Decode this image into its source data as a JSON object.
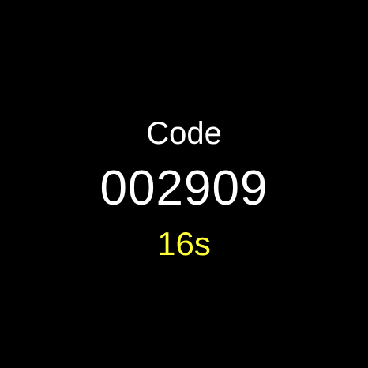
{
  "screen": {
    "label": "Code",
    "code": "002909",
    "timer": "16s"
  },
  "colors": {
    "background": "#000000",
    "text": "#ffffff",
    "timer": "#ffff33"
  }
}
